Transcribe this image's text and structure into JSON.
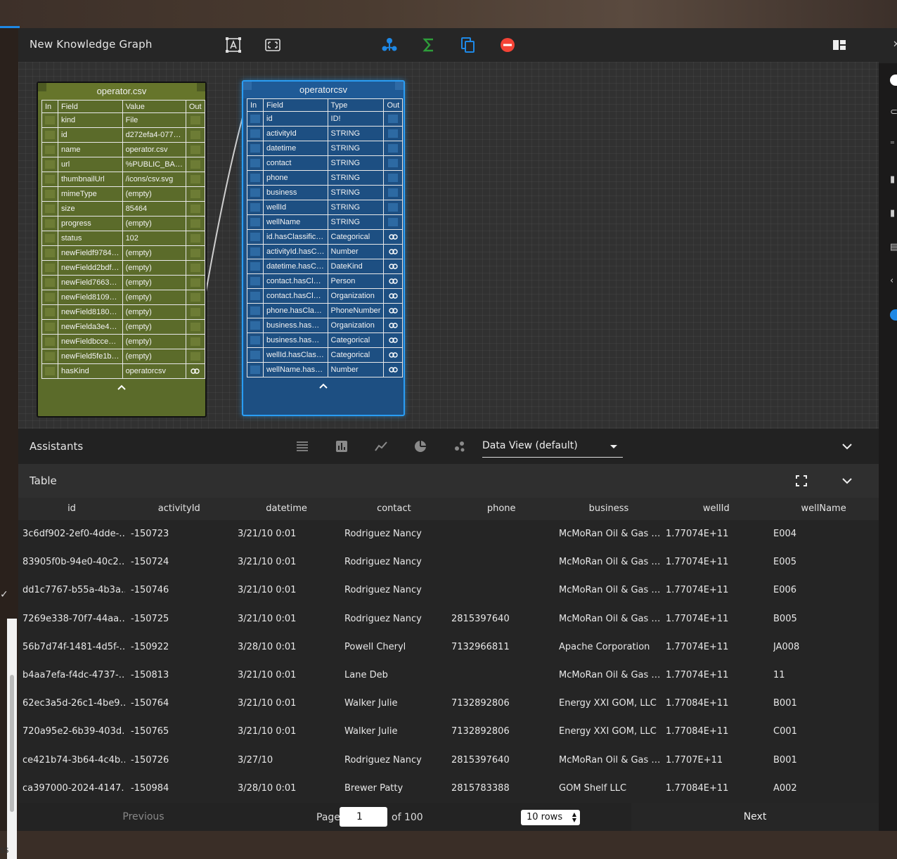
{
  "toolbar": {
    "title": "New Knowledge Graph",
    "icons": [
      "text-select-icon",
      "fullscreen-select-icon",
      "tree-icon",
      "sigma-icon",
      "copy-icon",
      "remove-icon",
      "layout-icon"
    ]
  },
  "file_node": {
    "title": "operator.csv",
    "headers": [
      "In",
      "Field",
      "Value",
      "Out"
    ],
    "rows": [
      {
        "field": "kind",
        "value": "File"
      },
      {
        "field": "id",
        "value": "d272efa4-077…"
      },
      {
        "field": "name",
        "value": "operator.csv"
      },
      {
        "field": "url",
        "value": "%PUBLIC_BA…"
      },
      {
        "field": "thumbnailUrl",
        "value": "/icons/csv.svg"
      },
      {
        "field": "mimeType",
        "value": "(empty)"
      },
      {
        "field": "size",
        "value": "85464"
      },
      {
        "field": "progress",
        "value": "(empty)"
      },
      {
        "field": "status",
        "value": "102"
      },
      {
        "field": "newFieldf9784…",
        "value": "(empty)"
      },
      {
        "field": "newFieldd2bdf…",
        "value": "(empty)"
      },
      {
        "field": "newField7663…",
        "value": "(empty)"
      },
      {
        "field": "newField8109…",
        "value": "(empty)"
      },
      {
        "field": "newField8180…",
        "value": "(empty)"
      },
      {
        "field": "newFielda3e4…",
        "value": "(empty)"
      },
      {
        "field": "newFieldbcce…",
        "value": "(empty)"
      },
      {
        "field": "newField5fe1b…",
        "value": "(empty)"
      },
      {
        "field": "hasKind",
        "value": "operatorcsv",
        "out_link": true
      }
    ]
  },
  "type_node": {
    "title": "operatorcsv",
    "headers": [
      "In",
      "Field",
      "Type",
      "Out"
    ],
    "rows": [
      {
        "field": "id",
        "type": "ID!"
      },
      {
        "field": "activityId",
        "type": "STRING"
      },
      {
        "field": "datetime",
        "type": "STRING"
      },
      {
        "field": "contact",
        "type": "STRING"
      },
      {
        "field": "phone",
        "type": "STRING"
      },
      {
        "field": "business",
        "type": "STRING"
      },
      {
        "field": "wellId",
        "type": "STRING"
      },
      {
        "field": "wellName",
        "type": "STRING"
      },
      {
        "field": "id.hasClassific…",
        "type": "Categorical",
        "out_link": true
      },
      {
        "field": "activityId.hasC…",
        "type": "Number",
        "out_link": true
      },
      {
        "field": "datetime.hasC…",
        "type": "DateKind",
        "out_link": true
      },
      {
        "field": "contact.hasCl…",
        "type": "Person",
        "out_link": true
      },
      {
        "field": "contact.hasCl…",
        "type": "Organization",
        "out_link": true
      },
      {
        "field": "phone.hasCla…",
        "type": "PhoneNumber",
        "out_link": true
      },
      {
        "field": "business.has…",
        "type": "Organization",
        "out_link": true
      },
      {
        "field": "business.has…",
        "type": "Categorical",
        "out_link": true
      },
      {
        "field": "wellId.hasClas…",
        "type": "Categorical",
        "out_link": true
      },
      {
        "field": "wellName.has…",
        "type": "Number",
        "out_link": true
      }
    ]
  },
  "assistants": {
    "label": "Assistants",
    "view_icons": [
      "list-view-icon",
      "bar-chart-icon",
      "line-chart-icon",
      "pie-chart-icon",
      "scatter-icon"
    ],
    "data_view": "Data View (default)"
  },
  "table": {
    "label": "Table",
    "columns": [
      "id",
      "activityId",
      "datetime",
      "contact",
      "phone",
      "business",
      "wellId",
      "wellName"
    ],
    "rows": [
      [
        "3c6df902-2ef0-4dde-…",
        "-150723",
        "3/21/10 0:01",
        "Rodriguez Nancy",
        "",
        "McMoRan Oil & Gas …",
        "1.77074E+11",
        "E004"
      ],
      [
        "83905f0b-94e0-40c2…",
        "-150724",
        "3/21/10 0:01",
        "Rodriguez Nancy",
        "",
        "McMoRan Oil & Gas …",
        "1.77074E+11",
        "E005"
      ],
      [
        "dd1c7767-b55a-4b3a…",
        "-150746",
        "3/21/10 0:01",
        "Rodriguez Nancy",
        "",
        "McMoRan Oil & Gas …",
        "1.77074E+11",
        "E006"
      ],
      [
        "7269e338-70f7-44aa…",
        "-150725",
        "3/21/10 0:01",
        "Rodriguez Nancy",
        "2815397640",
        "McMoRan Oil & Gas …",
        "1.77074E+11",
        "B005"
      ],
      [
        "56b7d74f-1481-4d5f-…",
        "-150922",
        "3/28/10 0:01",
        "Powell Cheryl",
        "7132966811",
        "Apache Corporation",
        "1.77074E+11",
        "JA008"
      ],
      [
        "b4aa7efa-f4dc-4737-…",
        "-150813",
        "3/21/10 0:01",
        "Lane Deb",
        "",
        "McMoRan Oil & Gas …",
        "1.77074E+11",
        "11"
      ],
      [
        "62ec3a5d-26c1-4be9…",
        "-150764",
        "3/21/10 0:01",
        "Walker Julie",
        "7132892806",
        "Energy XXI GOM, LLC",
        "1.77084E+11",
        "B001"
      ],
      [
        "720a95e2-6b39-403d…",
        "-150765",
        "3/21/10 0:01",
        "Walker Julie",
        "7132892806",
        "Energy XXI GOM, LLC",
        "1.77084E+11",
        "C001"
      ],
      [
        "ce421b74-3b64-4c4b…",
        "-150726",
        "3/27/10",
        "Rodriguez Nancy",
        "2815397640",
        "McMoRan Oil & Gas …",
        "1.7707E+11",
        "B001"
      ],
      [
        "ca397000-2024-4147…",
        "-150984",
        "3/28/10 0:01",
        "Brewer Patty",
        "2815783388",
        "GOM Shelf LLC",
        "1.77084E+11",
        "A002"
      ]
    ]
  },
  "pager": {
    "previous": "Previous",
    "page_label": "Page",
    "page_value": "1",
    "of_label": "of 100",
    "rows_select": "10 rows",
    "next": "Next"
  },
  "colors": {
    "file_node": "#5b6b2a",
    "type_node": "#1d4f82",
    "type_node_border": "#2a9df4",
    "accent": "#1e88e5",
    "remove": "#f44336",
    "sigma": "#2e9e3a"
  }
}
